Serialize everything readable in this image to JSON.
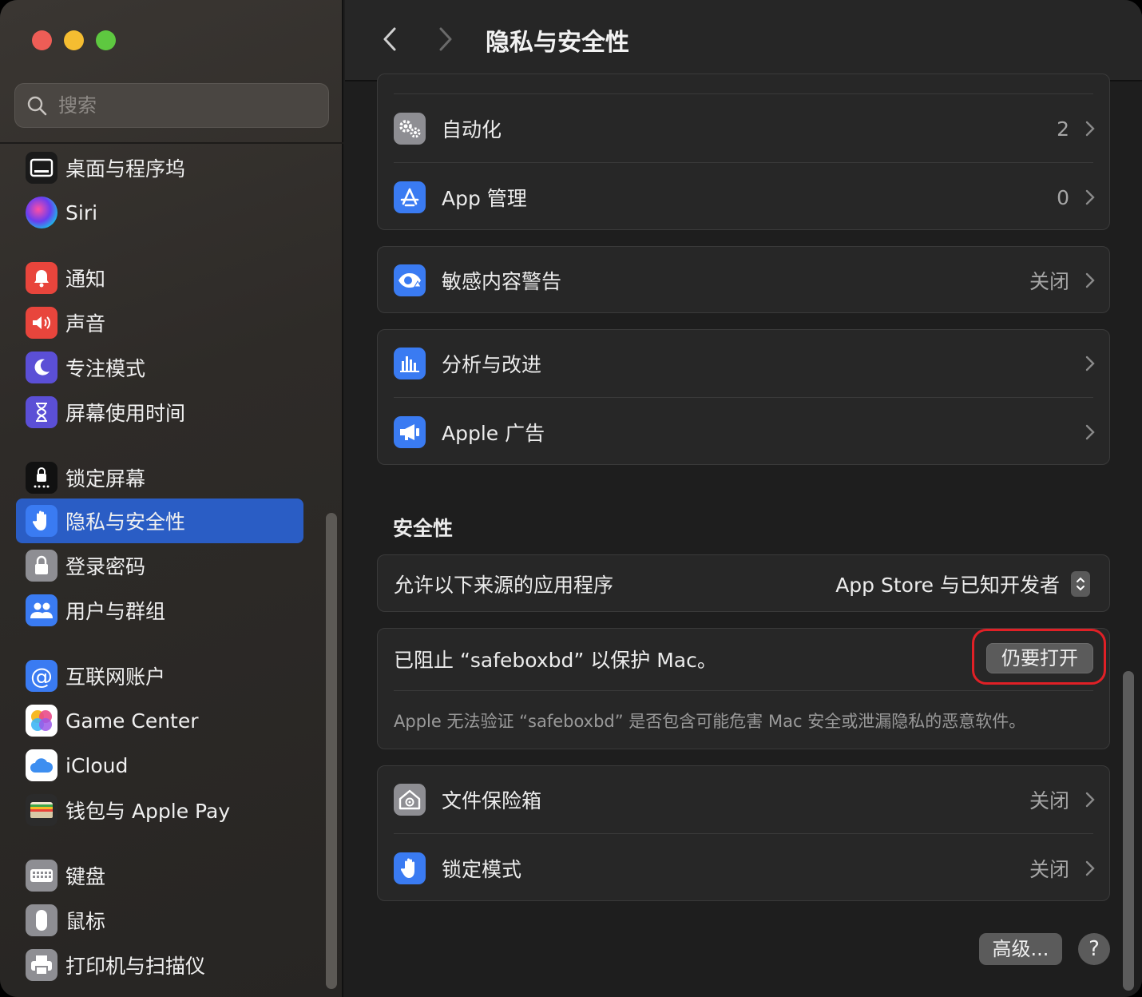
{
  "window": {
    "title": "隐私与安全性"
  },
  "search": {
    "placeholder": "搜索"
  },
  "sidebar": {
    "items": [
      {
        "label": "桌面与程序坞",
        "icon": "dock-icon",
        "color": "#1a1a1a"
      },
      {
        "label": "Siri",
        "icon": "siri-icon",
        "color": "#1a1a1a"
      },
      {
        "label": "通知",
        "icon": "bell-icon",
        "color": "#e8453c"
      },
      {
        "label": "声音",
        "icon": "speaker-icon",
        "color": "#e8453c"
      },
      {
        "label": "专注模式",
        "icon": "moon-icon",
        "color": "#5b4fd6"
      },
      {
        "label": "屏幕使用时间",
        "icon": "hourglass-icon",
        "color": "#5b4fd6"
      },
      {
        "label": "锁定屏幕",
        "icon": "lock-screen-icon",
        "color": "#111111"
      },
      {
        "label": "隐私与安全性",
        "icon": "hand-icon",
        "color": "#3a7bf2",
        "active": true
      },
      {
        "label": "登录密码",
        "icon": "padlock-icon",
        "color": "#8e8e93"
      },
      {
        "label": "用户与群组",
        "icon": "users-icon",
        "color": "#3a7bf2"
      },
      {
        "label": "互联网账户",
        "icon": "at-icon",
        "color": "#3a7bf2"
      },
      {
        "label": "Game Center",
        "icon": "game-center-icon",
        "color": "#ffffff"
      },
      {
        "label": "iCloud",
        "icon": "cloud-icon",
        "color": "#ffffff"
      },
      {
        "label": "钱包与 Apple Pay",
        "icon": "wallet-icon",
        "color": "#2b2b2b"
      },
      {
        "label": "键盘",
        "icon": "keyboard-icon",
        "color": "#8e8e93"
      },
      {
        "label": "鼠标",
        "icon": "mouse-icon",
        "color": "#8e8e93"
      },
      {
        "label": "打印机与扫描仪",
        "icon": "printer-icon",
        "color": "#8e8e93"
      }
    ]
  },
  "privacy": {
    "automation": {
      "label": "自动化",
      "value": "2"
    },
    "app_management": {
      "label": "App 管理",
      "value": "0"
    },
    "sensitive_content": {
      "label": "敏感内容警告",
      "value": "关闭"
    },
    "analytics": {
      "label": "分析与改进"
    },
    "apple_ads": {
      "label": "Apple 广告"
    }
  },
  "security": {
    "title": "安全性",
    "allow_apps_label": "允许以下来源的应用程序",
    "allow_apps_value": "App Store 与已知开发者",
    "blocked_text": "已阻止 “safeboxbd” 以保护 Mac。",
    "open_anyway": "仍要打开",
    "blocked_desc": "Apple 无法验证 “safeboxbd” 是否包含可能危害 Mac 安全或泄漏隐私的恶意软件。",
    "filevault": {
      "label": "文件保险箱",
      "value": "关闭"
    },
    "lockdown": {
      "label": "锁定模式",
      "value": "关闭"
    }
  },
  "footer": {
    "advanced": "高级...",
    "help": "?"
  }
}
